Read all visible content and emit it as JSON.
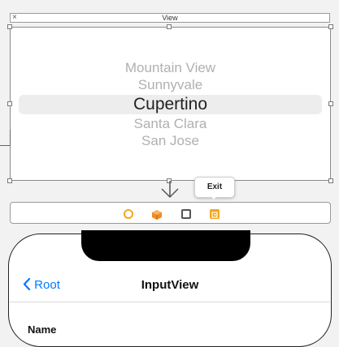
{
  "view_header": {
    "close_glyph": "×",
    "title": "View"
  },
  "picker": {
    "rows": [
      {
        "label": "Mountain View",
        "selected": false
      },
      {
        "label": "Sunnyvale",
        "selected": false
      },
      {
        "label": "Cupertino",
        "selected": true
      },
      {
        "label": "Santa Clara",
        "selected": false
      },
      {
        "label": "San Jose",
        "selected": false
      }
    ]
  },
  "exit_tooltip": {
    "label": "Exit"
  },
  "dock": {
    "icons": [
      {
        "name": "first-responder-icon",
        "color": "#f5a623"
      },
      {
        "name": "cube-icon",
        "color": "#f08a24"
      },
      {
        "name": "view-controller-icon",
        "color": "#555555"
      },
      {
        "name": "exit-icon",
        "color": "#f5a623"
      }
    ]
  },
  "phone": {
    "nav": {
      "back_label": "Root",
      "title": "InputView"
    },
    "form": {
      "first_label": "Name"
    }
  },
  "colors": {
    "ios_blue": "#007aff",
    "accent_orange": "#f5a623"
  }
}
